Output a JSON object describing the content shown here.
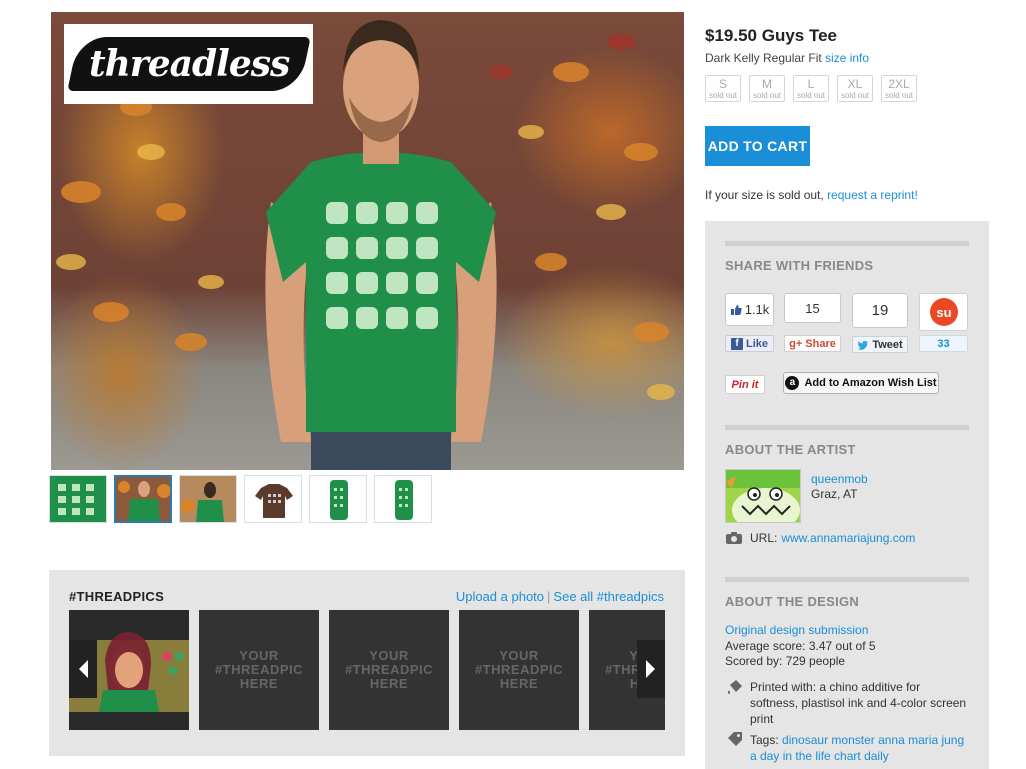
{
  "hero": {
    "logo_text": "threadless"
  },
  "product": {
    "title": "$19.50 Guys Tee",
    "fit": "Dark Kelly Regular Fit",
    "size_info_link": "size info",
    "sizes": [
      {
        "label": "S",
        "status": "sold out"
      },
      {
        "label": "M",
        "status": "sold out"
      },
      {
        "label": "L",
        "status": "sold out"
      },
      {
        "label": "XL",
        "status": "sold out"
      },
      {
        "label": "2XL",
        "status": "sold out"
      }
    ],
    "add_to_cart": "ADD TO CART",
    "reprint_text": "If your size is sold out, ",
    "reprint_link": "request a reprint!"
  },
  "threadpics": {
    "title": "#THREADPICS",
    "upload_link": "Upload a photo",
    "separator": "|",
    "see_all_link": "See all #threadpics",
    "placeholder_lines": [
      "YOUR",
      "#THREADPIC",
      "HERE"
    ]
  },
  "share": {
    "heading": "SHARE WITH FRIENDS",
    "facebook_count": "1.1k",
    "facebook_label": "Like",
    "gplus_count": "15",
    "gplus_label": "Share",
    "twitter_count": "19",
    "twitter_label": "Tweet",
    "stumble_count": "33",
    "pinit_label": "Pin it",
    "amazon_label": "Add to Amazon Wish List"
  },
  "artist": {
    "heading": "ABOUT THE ARTIST",
    "name": "queenmob",
    "location": "Graz, AT",
    "url_label": "URL:",
    "url": "www.annamariajung.com"
  },
  "design": {
    "heading": "ABOUT THE DESIGN",
    "submission_link": "Original design submission",
    "average_score": "Average score: 3.47 out of 5",
    "scored_by": "Scored by: 729 people",
    "printed_with": "Printed with: a chino additive for softness, plastisol ink and 4-color screen print",
    "tags_label": "Tags:",
    "tags": "dinosaur monster anna maria jung a day in the life chart daily"
  },
  "colors": {
    "accent": "#1a8ed6",
    "shirt": "#1f8f4a",
    "panel": "#e5e5e5"
  }
}
